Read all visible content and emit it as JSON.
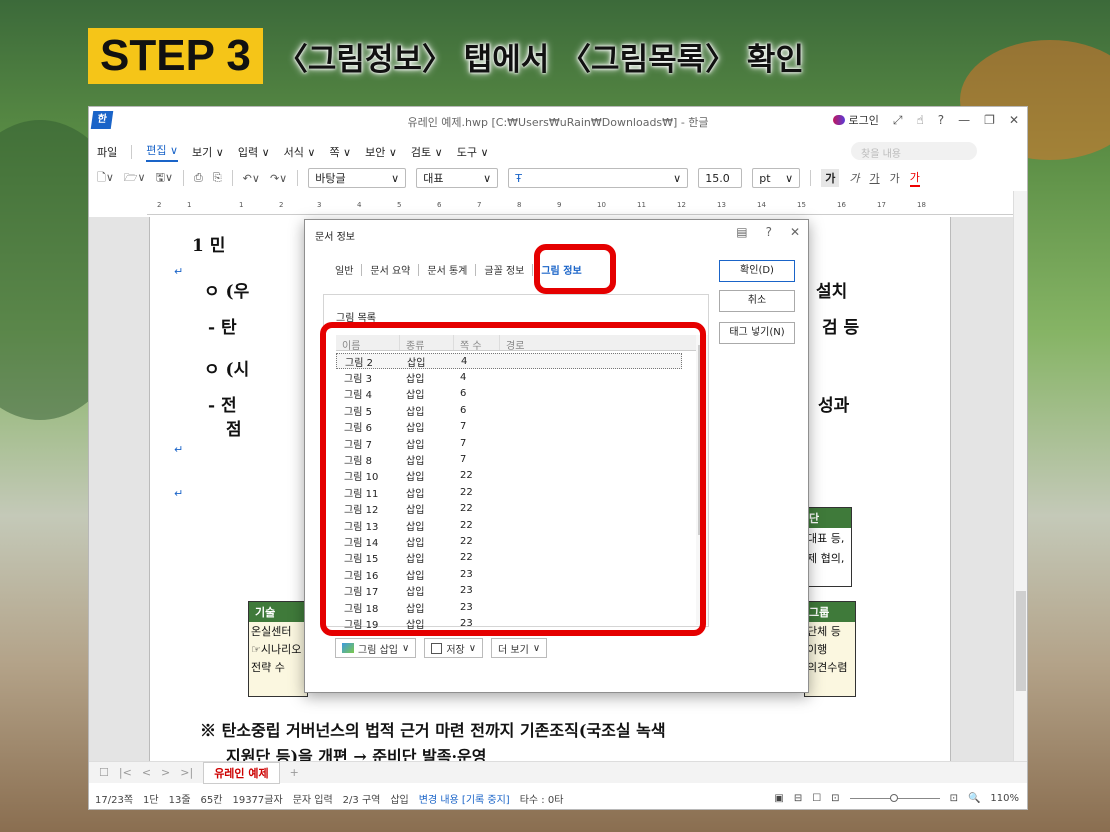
{
  "slide": {
    "step_label": "STEP 3",
    "title": "〈그림정보〉 탭에서 〈그림목록〉 확인"
  },
  "app": {
    "logo": "한",
    "window_title": "유레인 예제.hwp [C:₩Users₩uRain₩Downloads₩] - 한글",
    "login": "로그인",
    "search_placeholder": "찾을 내용"
  },
  "menubar": [
    {
      "label": "파일"
    },
    {
      "label": "편집 ∨",
      "selected": true
    },
    {
      "label": "보기 ∨"
    },
    {
      "label": "입력 ∨"
    },
    {
      "label": "서식 ∨"
    },
    {
      "label": "쪽 ∨"
    },
    {
      "label": "보안 ∨"
    },
    {
      "label": "검토 ∨"
    },
    {
      "label": "도구 ∨"
    }
  ],
  "toolbar": {
    "style": "바탕글",
    "font_group": "대표",
    "font_size": "15.0",
    "unit": "pt",
    "bold": "가",
    "italic": "가",
    "underline": "가",
    "strike": "가",
    "color": "가"
  },
  "ruler": [
    "2",
    "1",
    "1",
    "2",
    "3",
    "4",
    "5",
    "6",
    "7",
    "8",
    "9",
    "10",
    "11",
    "12",
    "13",
    "14",
    "15",
    "16",
    "17",
    "18"
  ],
  "document": {
    "lines": [
      {
        "text": "1  민"
      },
      {
        "text": "ㅇ (우"
      },
      {
        "text": "- 탄"
      },
      {
        "text": "ㅇ (시"
      },
      {
        "text": "- 전"
      },
      {
        "text": "점"
      },
      {
        "text": "설치"
      },
      {
        "text": "검 등"
      },
      {
        "text": "성과"
      },
      {
        "text": "※ 탄소중립 거버넌스의 법적 근거 마련 전까지 기존조직(국조실 녹색"
      },
      {
        "text": "지원단 등)을 개편 → 준비단 발족·운영"
      }
    ],
    "box_left_title": "기술",
    "box_left_lines": [
      "온실센터",
      "☞시나리오",
      "전략 수"
    ],
    "box_right_title_top": "단",
    "box_right_lines_top": [
      "대표 등,",
      "제 협의,"
    ],
    "box_right_title": "그룹",
    "box_right_lines": [
      "단체 등",
      "이행",
      "의견수렴"
    ]
  },
  "dialog": {
    "title": "문서 정보",
    "tabs": [
      "일반",
      "문서 요약",
      "문서 통계",
      "글꼴 정보",
      "그림 정보"
    ],
    "active_tab": "그림 정보",
    "panel_label": "그림 목록",
    "columns": [
      "이름",
      "종류",
      "쪽 수",
      "경로"
    ],
    "rows": [
      [
        "그림 2",
        "삽입",
        "4"
      ],
      [
        "그림 3",
        "삽입",
        "4"
      ],
      [
        "그림 4",
        "삽입",
        "6"
      ],
      [
        "그림 5",
        "삽입",
        "6"
      ],
      [
        "그림 6",
        "삽입",
        "7"
      ],
      [
        "그림 7",
        "삽입",
        "7"
      ],
      [
        "그림 8",
        "삽입",
        "7"
      ],
      [
        "그림 10",
        "삽입",
        "22"
      ],
      [
        "그림 11",
        "삽입",
        "22"
      ],
      [
        "그림 12",
        "삽입",
        "22"
      ],
      [
        "그림 13",
        "삽입",
        "22"
      ],
      [
        "그림 14",
        "삽입",
        "22"
      ],
      [
        "그림 15",
        "삽입",
        "22"
      ],
      [
        "그림 16",
        "삽입",
        "23"
      ],
      [
        "그림 17",
        "삽입",
        "23"
      ],
      [
        "그림 18",
        "삽입",
        "23"
      ],
      [
        "그림 19",
        "삽입",
        "23"
      ]
    ],
    "buttons": {
      "ok": "확인(D)",
      "cancel": "취소",
      "tag": "태그 넣기(N)"
    },
    "bottom": {
      "insert": "그림 삽입",
      "save": "저장",
      "more": "더 보기"
    }
  },
  "tabbar": {
    "doc_tab": "유레인 예제"
  },
  "statusbar": [
    "17/23쪽",
    "1단",
    "13줄",
    "65칸",
    "19377글자",
    "문자 입력",
    "2/3 구역",
    "삽입",
    "변경 내용 [기록 중지]",
    "타수 : 0타"
  ],
  "zoom": "110%",
  "colors": {
    "highlight": "#e50000",
    "step_bg": "#f5c518",
    "accent": "#1a64c8"
  }
}
